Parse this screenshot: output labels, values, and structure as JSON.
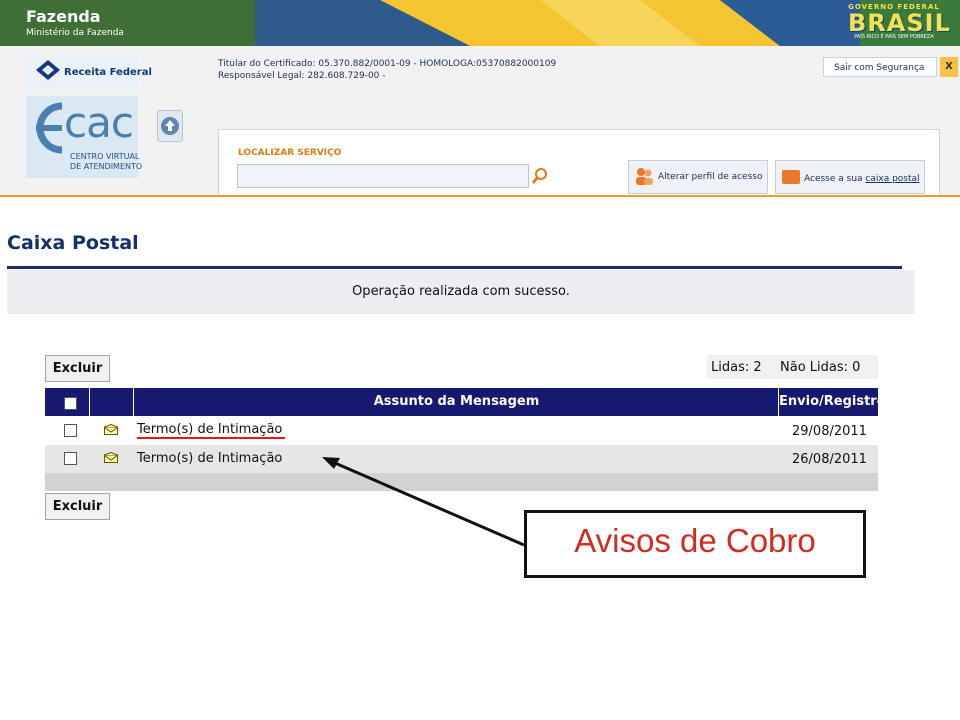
{
  "banner": {
    "title": "Fazenda",
    "subtitle": "Ministério da Fazenda",
    "gov_top": "GOVERNO FEDERAL",
    "gov_main": "BRASIL",
    "gov_sub": "PAÍS RICO É PAÍS SEM POBREZA"
  },
  "header": {
    "receita_label": "Receita Federal",
    "ecac_label": "cac",
    "ecac_sub_1": "CENTRO VIRTUAL",
    "ecac_sub_2": "DE ATENDIMENTO",
    "cert_line1": "Titular do Certificado: 05.370.882/0001-09 - HOMOLOGA:05370882000109",
    "cert_line2": "Responsável Legal: 282.608.729-00 -",
    "logout_label": "Sair com Segurança",
    "logout_x": "X",
    "search_label": "LOCALIZAR SERVIÇO",
    "search_value": "",
    "profile_label": "Alterar perfil de acesso",
    "mail_prefix": "Acesse a sua ",
    "mail_link": "caixa postal"
  },
  "page": {
    "title": "Caixa Postal",
    "success_message": "Operação realizada com sucesso.",
    "delete_label": "Excluir",
    "read_count": "Lidas: 2",
    "unread_count": "Não Lidas: 0"
  },
  "table": {
    "col_subject": "Assunto da Mensagem",
    "col_date": "Envio/Registro",
    "rows": [
      {
        "subject": "Termo(s) de Intimação",
        "date": "29/08/2011"
      },
      {
        "subject": "Termo(s) de Intimação",
        "date": "26/08/2011"
      }
    ]
  },
  "annotation": {
    "callout_text": "Avisos de Cobro",
    "underline_color": "#e31919"
  },
  "colors": {
    "table_header": "#17186f",
    "title": "#13306b",
    "accent_orange": "#f39a2b"
  }
}
